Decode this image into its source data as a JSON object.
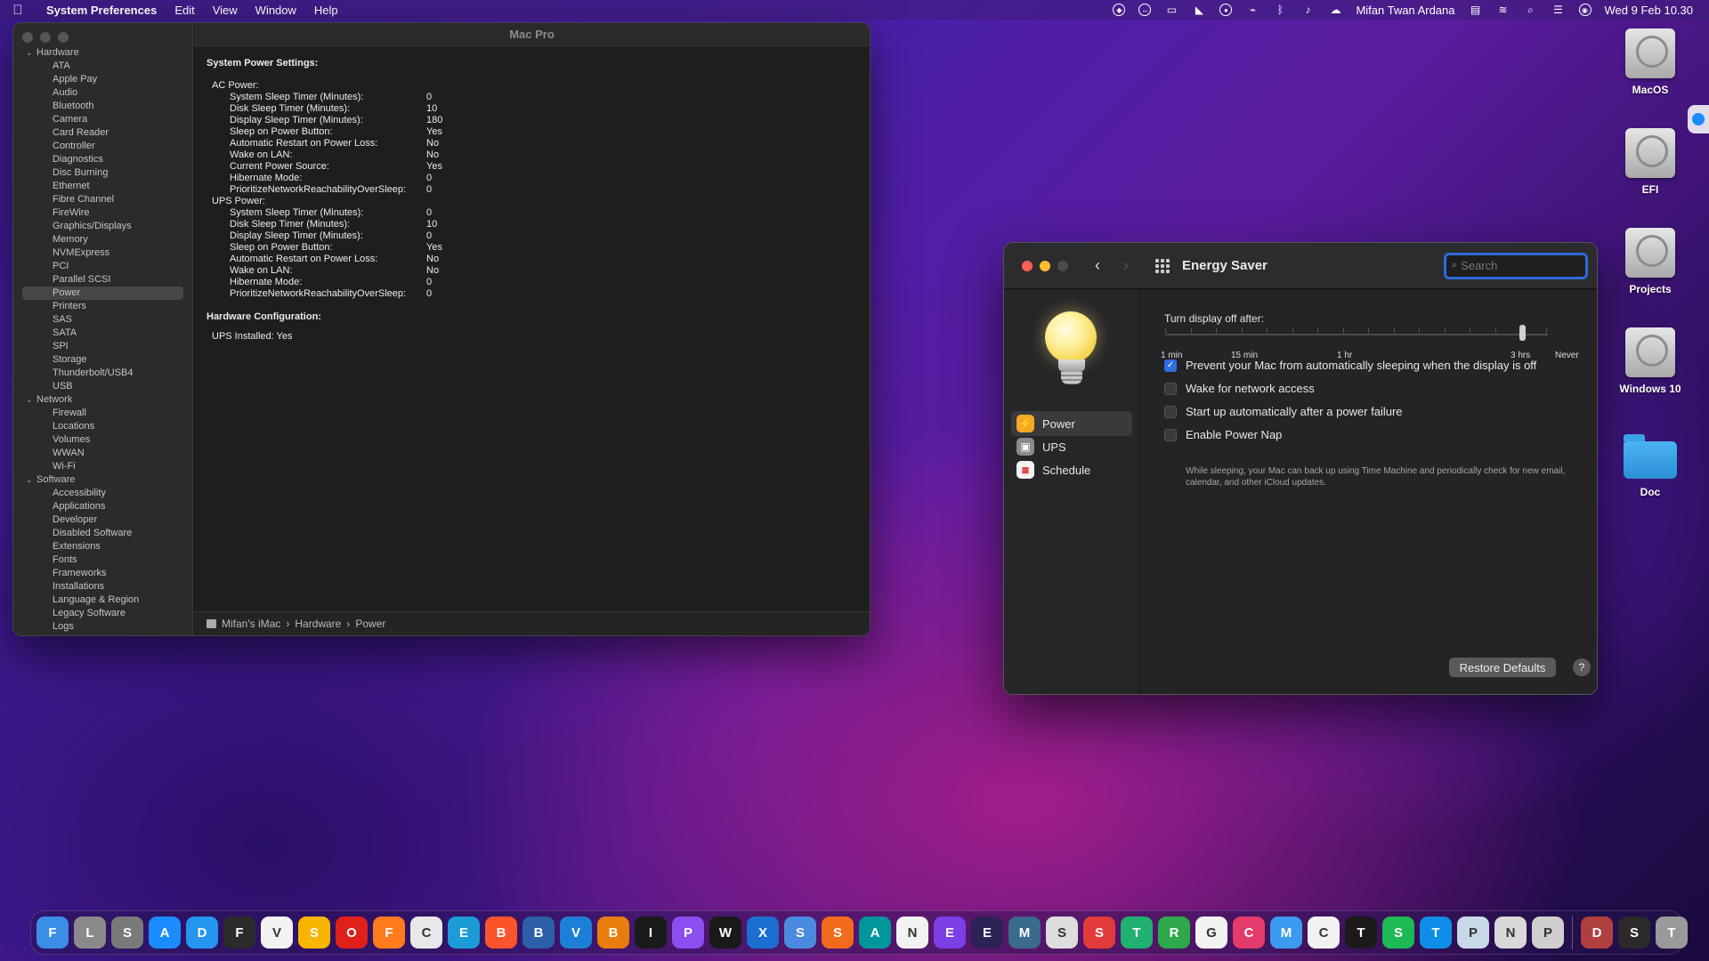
{
  "menubar": {
    "app_name": "System Preferences",
    "menus": [
      "Edit",
      "View",
      "Window",
      "Help"
    ],
    "user_name": "Mifan Twan Ardana",
    "clock": "Wed 9 Feb  10.30",
    "status_icons": [
      "shield-icon",
      "teamviewer-icon",
      "screen-icon",
      "dropzone-icon",
      "vpn-icon",
      "activity-monitor-icon",
      "bluetooth-icon",
      "volume-icon",
      "cloud-icon",
      "flag-us-icon",
      "wifi-icon",
      "search-icon",
      "control-center-icon",
      "siri-icon"
    ]
  },
  "sysinfo": {
    "title": "Mac Pro",
    "groups": [
      {
        "name": "Hardware",
        "items": [
          "ATA",
          "Apple Pay",
          "Audio",
          "Bluetooth",
          "Camera",
          "Card Reader",
          "Controller",
          "Diagnostics",
          "Disc Burning",
          "Ethernet",
          "Fibre Channel",
          "FireWire",
          "Graphics/Displays",
          "Memory",
          "NVMExpress",
          "PCI",
          "Parallel SCSI",
          "Power",
          "Printers",
          "SAS",
          "SATA",
          "SPI",
          "Storage",
          "Thunderbolt/USB4",
          "USB"
        ]
      },
      {
        "name": "Network",
        "items": [
          "Firewall",
          "Locations",
          "Volumes",
          "WWAN",
          "Wi-Fi"
        ]
      },
      {
        "name": "Software",
        "items": [
          "Accessibility",
          "Applications",
          "Developer",
          "Disabled Software",
          "Extensions",
          "Fonts",
          "Frameworks",
          "Installations",
          "Language & Region",
          "Legacy Software",
          "Logs"
        ]
      }
    ],
    "selected_item": "Power",
    "report": {
      "heading": "System Power Settings:",
      "ac_label": "AC Power:",
      "ac_rows": [
        [
          "System Sleep Timer (Minutes):",
          "0"
        ],
        [
          "Disk Sleep Timer (Minutes):",
          "10"
        ],
        [
          "Display Sleep Timer (Minutes):",
          "180"
        ],
        [
          "Sleep on Power Button:",
          "Yes"
        ],
        [
          "Automatic Restart on Power Loss:",
          "No"
        ],
        [
          "Wake on LAN:",
          "No"
        ],
        [
          "Current Power Source:",
          "Yes"
        ],
        [
          "Hibernate Mode:",
          "0"
        ],
        [
          "PrioritizeNetworkReachabilityOverSleep:",
          "0"
        ]
      ],
      "ups_label": "UPS Power:",
      "ups_rows": [
        [
          "System Sleep Timer (Minutes):",
          "0"
        ],
        [
          "Disk Sleep Timer (Minutes):",
          "10"
        ],
        [
          "Display Sleep Timer (Minutes):",
          "0"
        ],
        [
          "Sleep on Power Button:",
          "Yes"
        ],
        [
          "Automatic Restart on Power Loss:",
          "No"
        ],
        [
          "Wake on LAN:",
          "No"
        ],
        [
          "Hibernate Mode:",
          "0"
        ],
        [
          "PrioritizeNetworkReachabilityOverSleep:",
          "0"
        ]
      ],
      "hw_heading": "Hardware Configuration:",
      "hw_row": "UPS Installed:   Yes"
    },
    "breadcrumb": [
      "Mifan's iMac",
      "Hardware",
      "Power"
    ]
  },
  "energy": {
    "title": "Energy Saver",
    "search_placeholder": "Search",
    "panes": [
      {
        "label": "Power",
        "icon": "lightning-icon"
      },
      {
        "label": "UPS",
        "icon": "ups-icon"
      },
      {
        "label": "Schedule",
        "icon": "calendar-icon"
      }
    ],
    "selected_pane": "Power",
    "slider_label": "Turn display off after:",
    "slider_marks": [
      "1 min",
      "15 min",
      "1 hr",
      "3 hrs",
      "Never"
    ],
    "slider_value": "3 hrs",
    "options": [
      {
        "label": "Prevent your Mac from automatically sleeping when the display is off",
        "checked": true
      },
      {
        "label": "Wake for network access",
        "checked": false
      },
      {
        "label": "Start up automatically after a power failure",
        "checked": false
      },
      {
        "label": "Enable Power Nap",
        "checked": false
      }
    ],
    "power_nap_help": "While sleeping, your Mac can back up using Time Machine and periodically check for new email, calendar, and other iCloud updates.",
    "restore_label": "Restore Defaults",
    "help_label": "?"
  },
  "desktop": {
    "icons": [
      {
        "label": "MacOS",
        "kind": "disk"
      },
      {
        "label": "EFI",
        "kind": "disk"
      },
      {
        "label": "Projects",
        "kind": "disk"
      },
      {
        "label": "Windows 10",
        "kind": "disk"
      },
      {
        "label": "Doc",
        "kind": "folder"
      }
    ]
  },
  "dock": {
    "apps": [
      {
        "name": "finder-icon",
        "color": "#3a8ee6"
      },
      {
        "name": "launchpad-icon",
        "color": "#8a8a8a"
      },
      {
        "name": "system-preferences-icon",
        "color": "#7a7a7a"
      },
      {
        "name": "app-store-icon",
        "color": "#1a8cff"
      },
      {
        "name": "docker-icon",
        "color": "#2496ed"
      },
      {
        "name": "figma-icon",
        "color": "#2b2b2b"
      },
      {
        "name": "vivaldi-icon",
        "color": "#f2f2f2"
      },
      {
        "name": "sketch-icon",
        "color": "#f7b500"
      },
      {
        "name": "opera-icon",
        "color": "#e0201b"
      },
      {
        "name": "firefox-icon",
        "color": "#ff7b1c"
      },
      {
        "name": "chrome-icon",
        "color": "#e8e8e8"
      },
      {
        "name": "edge-icon",
        "color": "#1c9bd6"
      },
      {
        "name": "brave-icon",
        "color": "#fb542b"
      },
      {
        "name": "bitwarden-icon",
        "color": "#2d5fa8"
      },
      {
        "name": "vscode-icon",
        "color": "#1d7fd6"
      },
      {
        "name": "blender-icon",
        "color": "#e87d0d"
      },
      {
        "name": "intellij-icon",
        "color": "#1a1a1a"
      },
      {
        "name": "phpstorm-icon",
        "color": "#8b4ff0"
      },
      {
        "name": "webstorm-icon",
        "color": "#1a1a1a"
      },
      {
        "name": "xcode-icon",
        "color": "#1c6fd1"
      },
      {
        "name": "swift-icon",
        "color": "#4a8be0"
      },
      {
        "name": "sublime-icon",
        "color": "#f26b1d"
      },
      {
        "name": "arduino-icon",
        "color": "#00979c"
      },
      {
        "name": "notion-icon",
        "color": "#f2f2f2"
      },
      {
        "name": "elementor-icon",
        "color": "#7b3fe4"
      },
      {
        "name": "eclipse-icon",
        "color": "#2c2255"
      },
      {
        "name": "mysql-workbench-icon",
        "color": "#3a6b8c"
      },
      {
        "name": "sequel-ace-icon",
        "color": "#dddddd"
      },
      {
        "name": "scrivener-icon",
        "color": "#e33b3b"
      },
      {
        "name": "tableplus-icon",
        "color": "#20b070"
      },
      {
        "name": "rocket-icon",
        "color": "#2ea84a"
      },
      {
        "name": "github-icon",
        "color": "#f2f2f2"
      },
      {
        "name": "creative-cloud-icon",
        "color": "#e33b6a"
      },
      {
        "name": "mail-icon",
        "color": "#3a9bf0"
      },
      {
        "name": "calendar-icon",
        "color": "#f2f2f2"
      },
      {
        "name": "terminal-icon",
        "color": "#1b1b1b"
      },
      {
        "name": "spotify-icon",
        "color": "#1db954"
      },
      {
        "name": "teamviewer-icon",
        "color": "#0e8ee9"
      },
      {
        "name": "preview-icon",
        "color": "#c8d8e8"
      },
      {
        "name": "notes-icon",
        "color": "#d8d8d8"
      },
      {
        "name": "printer-icon",
        "color": "#cfcfcf"
      },
      {
        "name": "downloads-stack-icon",
        "color": "#b04040"
      },
      {
        "name": "screenshot-stack-icon",
        "color": "#2a2a2a"
      },
      {
        "name": "trash-icon",
        "color": "#9a9a9a"
      }
    ]
  }
}
